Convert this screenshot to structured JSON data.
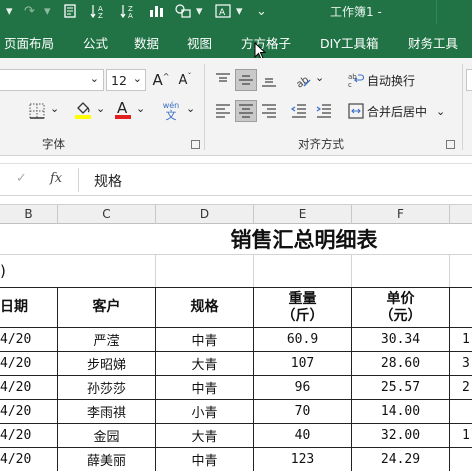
{
  "titlebar": {
    "title": "工作簿1",
    "title_suffix": "-",
    "quick_access_icons": [
      "redo-icon",
      "format-painter-icon",
      "sort-icon",
      "chart-icon",
      "shapes-icon",
      "print-preview-icon",
      "text-box-icon",
      "customize-icon"
    ]
  },
  "tabs": [
    "页面布局",
    "公式",
    "数据",
    "视图",
    "方方格子",
    "DIY工具箱",
    "财务工具"
  ],
  "font_group": {
    "label": "字体",
    "font_size": "12",
    "grow_label": "A",
    "shrink_label": "A",
    "wen_label": "wén",
    "wen_char": "文",
    "font_color_label": "A"
  },
  "alignment_group": {
    "label": "对齐方式",
    "wrap_text": "自动换行",
    "merge_center": "合并后居中"
  },
  "formula_bar": {
    "fx": "fx",
    "content": "规格"
  },
  "columns": [
    "B",
    "C",
    "D",
    "E",
    "F"
  ],
  "sheet": {
    "title": "销售汇总明细表",
    "row2_fragment": ")",
    "headers": {
      "date": "日期",
      "customer": "客户",
      "spec": "规格",
      "weight_line1": "重量",
      "weight_line2": "（斤）",
      "price_line1": "单价",
      "price_line2": "（元）"
    },
    "rows": [
      {
        "date": "4/20",
        "customer": "严滢",
        "spec": "中青",
        "weight": "60.9",
        "price": "30.34",
        "extra": "1"
      },
      {
        "date": "4/20",
        "customer": "步昭娣",
        "spec": "大青",
        "weight": "107",
        "price": "28.60",
        "extra": "3"
      },
      {
        "date": "4/20",
        "customer": "孙莎莎",
        "spec": "中青",
        "weight": "96",
        "price": "25.57",
        "extra": "2"
      },
      {
        "date": "4/20",
        "customer": "李雨祺",
        "spec": "小青",
        "weight": "70",
        "price": "14.00",
        "extra": ""
      },
      {
        "date": "4/20",
        "customer": "金园",
        "spec": "大青",
        "weight": "40",
        "price": "32.00",
        "extra": "1"
      },
      {
        "date": "4/20",
        "customer": "薛美丽",
        "spec": "中青",
        "weight": "123",
        "price": "24.29",
        "extra": ""
      }
    ]
  },
  "colors": {
    "excel_green": "#217346",
    "font_color_red": "#e02020",
    "highlight_yellow": "#ffff00"
  }
}
